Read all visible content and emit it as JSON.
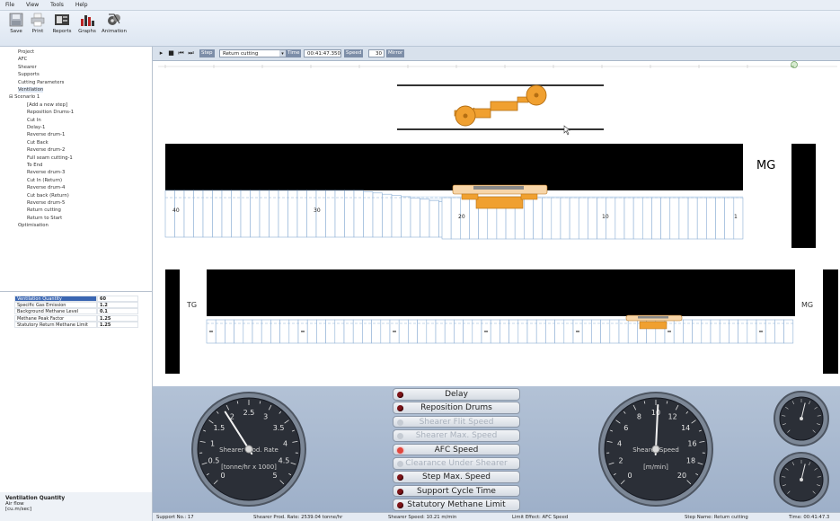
{
  "menu": [
    "File",
    "View",
    "Tools",
    "Help"
  ],
  "toolbar": [
    {
      "label": "Save",
      "icon": "save-icon"
    },
    {
      "label": "Print",
      "icon": "print-icon"
    },
    {
      "label": "Reports",
      "icon": "reports-icon"
    },
    {
      "label": "Graphs",
      "icon": "graphs-icon"
    },
    {
      "label": "Animation",
      "icon": "animation-icon"
    }
  ],
  "tree": [
    {
      "label": "Project",
      "level": 1
    },
    {
      "label": "AFC",
      "level": 1
    },
    {
      "label": "Shearer",
      "level": 1
    },
    {
      "label": "Supports",
      "level": 1
    },
    {
      "label": "Cutting Parameters",
      "level": 1
    },
    {
      "label": "Ventilation",
      "level": 1,
      "selected": true
    },
    {
      "label": "Scenario 1",
      "level": 0,
      "expander": "⊟"
    },
    {
      "label": "[Add a new step]",
      "level": 2
    },
    {
      "label": "Reposition Drums-1",
      "level": 2
    },
    {
      "label": "Cut In",
      "level": 2
    },
    {
      "label": "Delay-1",
      "level": 2
    },
    {
      "label": "Reverse drum-1",
      "level": 2
    },
    {
      "label": "Cut Back",
      "level": 2
    },
    {
      "label": "Reverse drum-2",
      "level": 2
    },
    {
      "label": "Full seam cutting-1",
      "level": 2
    },
    {
      "label": "To End",
      "level": 2
    },
    {
      "label": "Reverse drum-3",
      "level": 2
    },
    {
      "label": "Cut In (Return)",
      "level": 2
    },
    {
      "label": "Reverse drum-4",
      "level": 2
    },
    {
      "label": "Cut back (Return)",
      "level": 2
    },
    {
      "label": "Reverse drum-5",
      "level": 2
    },
    {
      "label": "Return cutting",
      "level": 2
    },
    {
      "label": "Return to Start",
      "level": 2
    },
    {
      "label": "Optimisation",
      "level": 1
    }
  ],
  "properties": [
    {
      "name": "Ventilation Quantity",
      "value": "60",
      "highlight": true
    },
    {
      "name": "Specific Gas Emission",
      "value": "1.2"
    },
    {
      "name": "Background Methane Level",
      "value": "0.1"
    },
    {
      "name": "Methane Peak Factor",
      "value": "1.25"
    },
    {
      "name": "Statutory Return Methane Limit",
      "value": "1.25"
    }
  ],
  "property_desc": {
    "title": "Ventilation Quantity",
    "line1": "Air flow",
    "line2": "[cu.m/sec]"
  },
  "controls": {
    "step_label": "Step",
    "step_value": "Return cutting",
    "time_label": "Time",
    "time_value": "00:41:47.350",
    "speed_label": "Speed",
    "speed_value": "30",
    "mirror_label": "Mirror"
  },
  "face": {
    "mg_label": "MG",
    "tg_label": "TG",
    "support_numbers_top": [
      "40",
      "30",
      "20",
      "10",
      "1"
    ]
  },
  "gauges": {
    "prod": {
      "title": "Shearer Prod. Rate",
      "unit": "[tonne/hr x 1000]",
      "ticks": [
        "0",
        "0.5",
        "1",
        "1.5",
        "2",
        "2.5",
        "3",
        "3.5",
        "4",
        "4.5",
        "5"
      ],
      "value": 1.9,
      "max": 5
    },
    "speed": {
      "title": "Shearer Speed",
      "unit": "[m/min]",
      "ticks": [
        "0",
        "2",
        "4",
        "6",
        "8",
        "10",
        "12",
        "14",
        "16",
        "18",
        "20"
      ],
      "value": 10.2,
      "max": 20
    }
  },
  "indicators": [
    {
      "label": "Delay",
      "state": "off"
    },
    {
      "label": "Reposition Drums",
      "state": "off"
    },
    {
      "label": "Shearer Flit Speed",
      "state": "disabled"
    },
    {
      "label": "Shearer Max. Speed",
      "state": "disabled"
    },
    {
      "label": "AFC Speed",
      "state": "on"
    },
    {
      "label": "Clearance Under Shearer",
      "state": "disabled"
    },
    {
      "label": "Step Max. Speed",
      "state": "off"
    },
    {
      "label": "Support Cycle Time",
      "state": "off"
    },
    {
      "label": "Statutory Methane Limit",
      "state": "off"
    }
  ],
  "status": {
    "support": "Support No.:  17",
    "prod_rate": "Shearer Prod. Rate:  2539.04 tonne/hr",
    "speed": "Shearer Speed:  10.21 m/min",
    "limit": "Limit Effect:  AFC Speed",
    "step": "Step Name:  Return cutting",
    "time": "Time:  00:41:47.3"
  },
  "colors": {
    "accent": "#f0a030",
    "selection": "#3a66b2",
    "panel": "#a8b8cf"
  }
}
